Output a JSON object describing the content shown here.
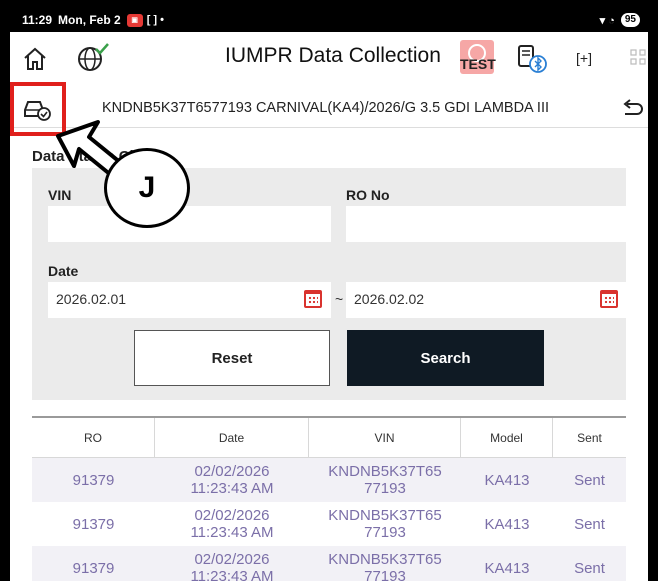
{
  "status_bar": {
    "time": "11:29",
    "date": "Mon, Feb 2",
    "misc": "[ ] •",
    "signals": "▾ ◔",
    "battery": "95"
  },
  "header": {
    "title": "IUMPR Data Collection",
    "test_label": "TEST",
    "plus_label": "[+]"
  },
  "vehicle": {
    "text": "KNDNB5K37T6577193 CARNIVAL(KA4)/2026/G 3.5 GDI LAMBDA III"
  },
  "section": {
    "title": "Data Status Check"
  },
  "form": {
    "vin_label": "VIN",
    "vin_value": "",
    "ro_label": "RO No",
    "ro_value": "",
    "date_label": "Date",
    "date_from": "2026.02.01",
    "date_to": "2026.02.02",
    "date_sep": "~",
    "reset_label": "Reset",
    "search_label": "Search"
  },
  "table": {
    "columns": [
      "RO",
      "Date",
      "VIN",
      "Model",
      "Sent"
    ],
    "rows": [
      {
        "ro": "91379",
        "date1": "02/02/2026",
        "date2": "11:23:43 AM",
        "vin1": "KNDNB5K37T65",
        "vin2": "77193",
        "model": "KA413",
        "sent": "Sent"
      },
      {
        "ro": "91379",
        "date1": "02/02/2026",
        "date2": "11:23:43 AM",
        "vin1": "KNDNB5K37T65",
        "vin2": "77193",
        "model": "KA413",
        "sent": "Sent"
      },
      {
        "ro": "91379",
        "date1": "02/02/2026",
        "date2": "11:23:43 AM",
        "vin1": "KNDNB5K37T65",
        "vin2": "77193",
        "model": "KA413",
        "sent": "Sent"
      }
    ]
  },
  "callout": {
    "label": "J"
  },
  "colors": {
    "highlight": "#e0201c",
    "search_bg": "#0f1a24",
    "row_text": "#7b6fa8",
    "calendar": "#d9332e"
  },
  "icons": [
    "home-icon",
    "globe-check-icon",
    "steering-wheel-icon",
    "vci-bluetooth-icon",
    "plus-frame-icon",
    "grid-icon",
    "car-check-icon",
    "return-icon",
    "calendar-icon"
  ]
}
